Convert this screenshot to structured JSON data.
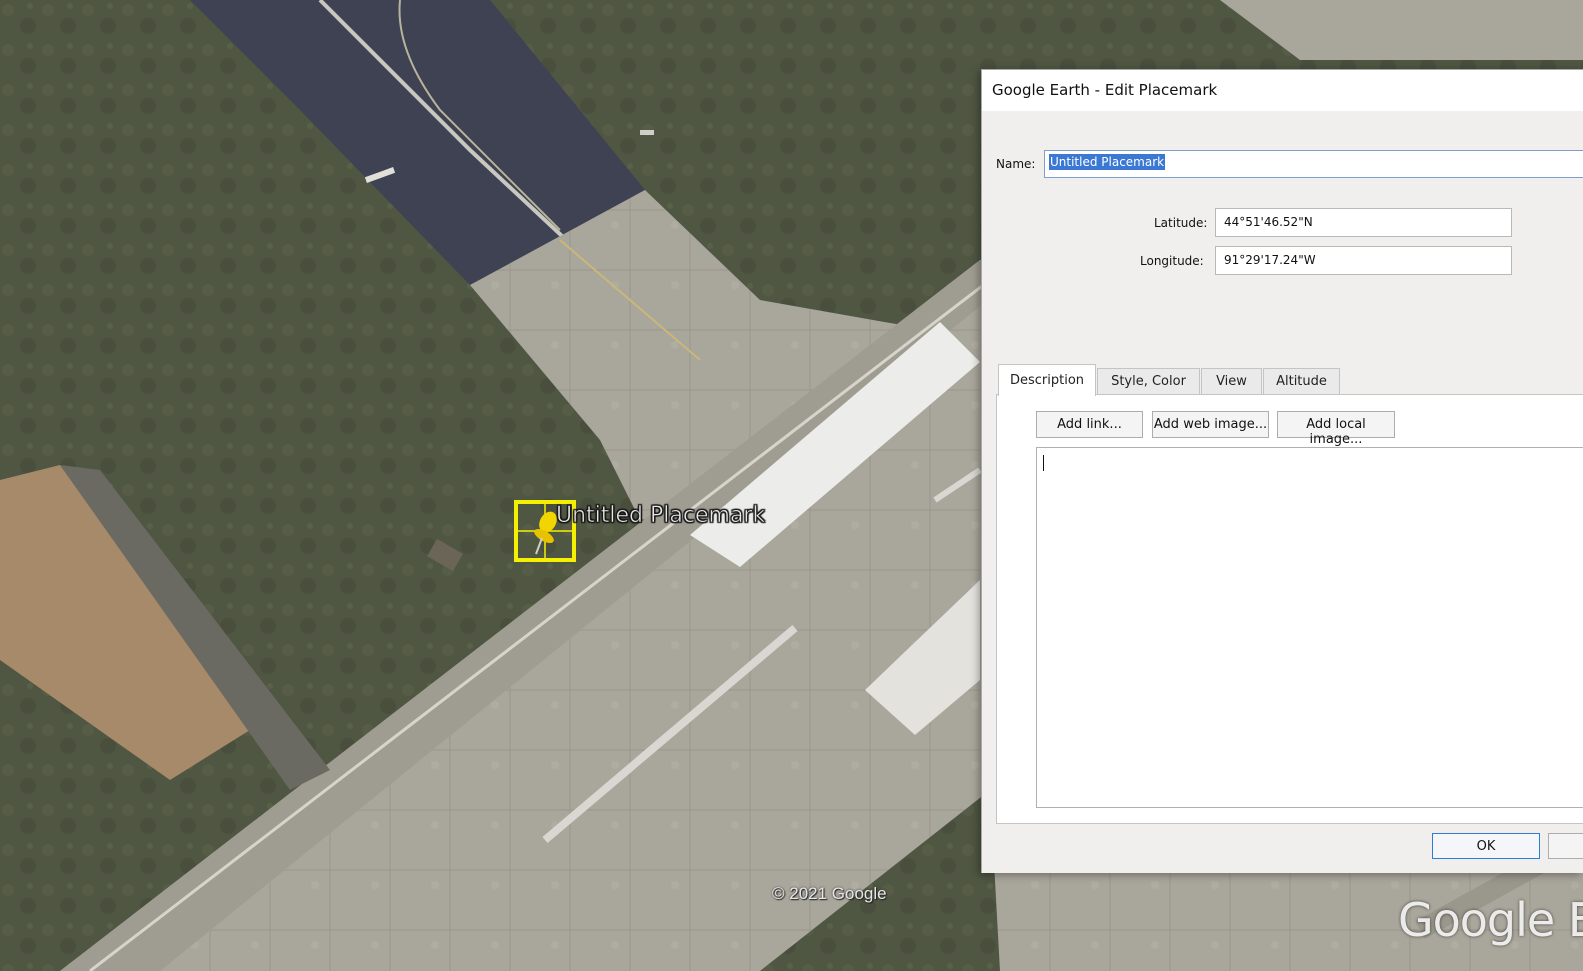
{
  "map": {
    "placemark_label": "Untitled Placemark",
    "copyright": "© 2021 Google",
    "watermark": "Google Earth",
    "colors": {
      "grass": "#4f5642",
      "runway_concrete": "#a9a69b",
      "asphalt": "#3e4252",
      "pin_highlight": "#f5f000"
    }
  },
  "dialog": {
    "title": "Google Earth - Edit Placemark",
    "name_label": "Name:",
    "name_value": "Untitled Placemark",
    "latitude_label": "Latitude:",
    "latitude_value": "44°51'46.52\"N",
    "longitude_label": "Longitude:",
    "longitude_value": "91°29'17.24\"W",
    "tabs": [
      {
        "label": "Description",
        "active": true
      },
      {
        "label": "Style, Color",
        "active": false
      },
      {
        "label": "View",
        "active": false
      },
      {
        "label": "Altitude",
        "active": false
      }
    ],
    "buttons": {
      "add_link": "Add link...",
      "add_web_image": "Add web image...",
      "add_local_image": "Add local image...",
      "ok": "OK"
    },
    "description_value": ""
  }
}
